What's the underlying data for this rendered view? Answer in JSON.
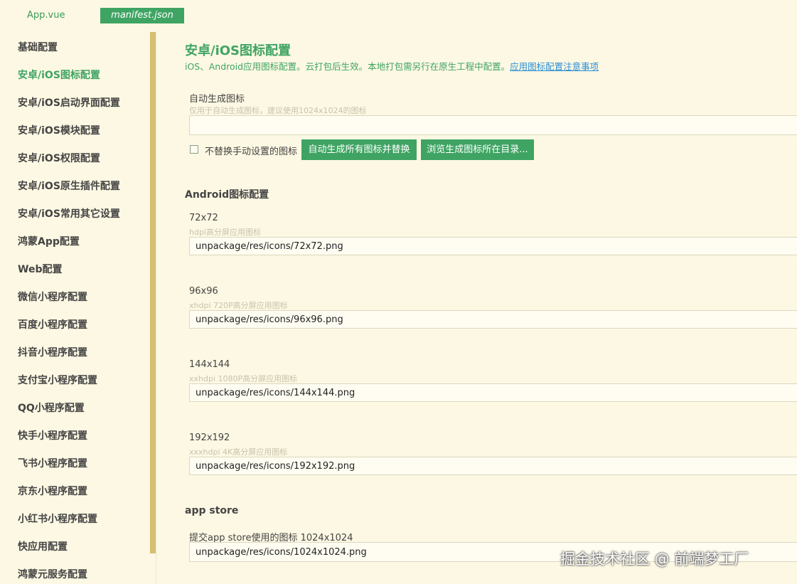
{
  "tabs": {
    "app": "App.vue",
    "manifest": "manifest.json"
  },
  "sidebar": {
    "items": [
      {
        "label": "基础配置"
      },
      {
        "label": "安卓/iOS图标配置"
      },
      {
        "label": "安卓/iOS启动界面配置"
      },
      {
        "label": "安卓/iOS模块配置"
      },
      {
        "label": "安卓/iOS权限配置"
      },
      {
        "label": "安卓/iOS原生插件配置"
      },
      {
        "label": "安卓/iOS常用其它设置"
      },
      {
        "label": "鸿蒙App配置"
      },
      {
        "label": "Web配置"
      },
      {
        "label": "微信小程序配置"
      },
      {
        "label": "百度小程序配置"
      },
      {
        "label": "抖音小程序配置"
      },
      {
        "label": "支付宝小程序配置"
      },
      {
        "label": "QQ小程序配置"
      },
      {
        "label": "快手小程序配置"
      },
      {
        "label": "飞书小程序配置"
      },
      {
        "label": "京东小程序配置"
      },
      {
        "label": "小红书小程序配置"
      },
      {
        "label": "快应用配置"
      },
      {
        "label": "鸿蒙元服务配置"
      }
    ],
    "active_index": 1
  },
  "main": {
    "title": "安卓/iOS图标配置",
    "desc": "iOS、Android应用图标配置。云打包后生效。本地打包需另行在原生工程中配置。",
    "desc_link": "应用图标配置注意事项",
    "auto": {
      "label": "自动生成图标",
      "hint": "仅用于自动生成图标，建议使用1024x1024的图标",
      "value": "",
      "checkbox_label": "不替换手动设置的图标",
      "checked": false,
      "btn_generate": "自动生成所有图标并替换",
      "btn_browse": "浏览生成图标所在目录..."
    },
    "android": {
      "title": "Android图标配置",
      "fields": [
        {
          "label": "72x72",
          "hint": "hdpi高分屏应用图标",
          "value": "unpackage/res/icons/72x72.png"
        },
        {
          "label": "96x96",
          "hint": "xhdpi 720P高分屏应用图标",
          "value": "unpackage/res/icons/96x96.png"
        },
        {
          "label": "144x144",
          "hint": "xxhdpi 1080P高分屏应用图标",
          "value": "unpackage/res/icons/144x144.png"
        },
        {
          "label": "192x192",
          "hint": "xxxhdpi 4K高分屏应用图标",
          "value": "unpackage/res/icons/192x192.png"
        }
      ]
    },
    "appstore": {
      "title": "app store",
      "label": "提交app store使用的图标 1024x1024",
      "value": "unpackage/res/icons/1024x1024.png"
    }
  },
  "watermark": "掘金技术社区 @ 前端梦工厂",
  "colors": {
    "accent": "#3fa463",
    "background": "#fdf8e3",
    "rail": "#d4bf72",
    "link": "#2b8fd6"
  }
}
